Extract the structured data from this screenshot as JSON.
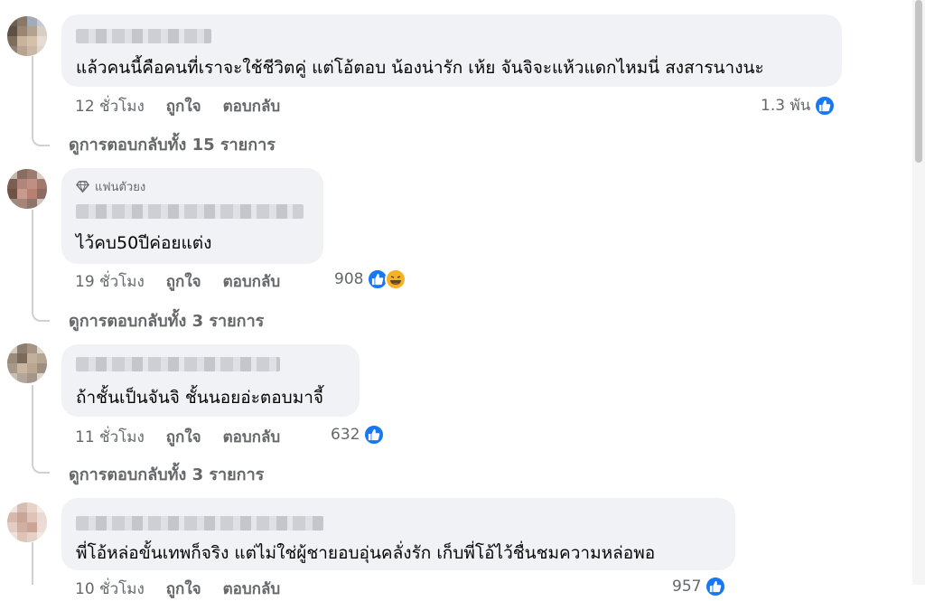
{
  "comments": [
    {
      "text": "แล้วคนนี้คือคนที่เราจะใช้ชีวิตคู่ แต่โอ้ตอบ น้องน่ารัก เห้ย จันจิจะแห้วแดกไหมนี่ สงสารนางนะ",
      "time": "12 ชั่วโมง",
      "like": "ถูกใจ",
      "reply": "ตอบกลับ",
      "reactions": "1.3 พัน",
      "reaction_icons": [
        "like-icon"
      ],
      "view_replies": "ดูการตอบกลับทั้ง 15 รายการ"
    },
    {
      "badge": "แฟนตัวยง",
      "text": "ไว้คบ50ปีค่อยแต่ง",
      "time": "19 ชั่วโมง",
      "like": "ถูกใจ",
      "reply": "ตอบกลับ",
      "reactions": "908",
      "reaction_icons": [
        "like-icon",
        "haha-icon"
      ],
      "view_replies": "ดูการตอบกลับทั้ง 3 รายการ"
    },
    {
      "text": "ถ้าชั้นเป็นจันจิ ชั้นนอยอ่ะตอบมาจี้",
      "time": "11 ชั่วโมง",
      "like": "ถูกใจ",
      "reply": "ตอบกลับ",
      "reactions": "632",
      "reaction_icons": [
        "like-icon"
      ],
      "view_replies": "ดูการตอบกลับทั้ง 3 รายการ"
    },
    {
      "text": "พี่โอ้หล่อขั้นเทพก็จริง แต่ไม่ใช่ผู้ชายอบอุ่นคลั่งรัก เก็บพี่โอ้ไว้ชื่นชมความหล่อพอ",
      "time": "10 ชั่วโมง",
      "like": "ถูกใจ",
      "reply": "ตอบกลับ",
      "reactions": "957",
      "reaction_icons": [
        "like-icon"
      ]
    }
  ],
  "colors": {
    "bubble": "#f0f2f5",
    "meta_text": "#65676b",
    "like_blue": "#1877f2",
    "haha_yellow": "#f7b125"
  }
}
